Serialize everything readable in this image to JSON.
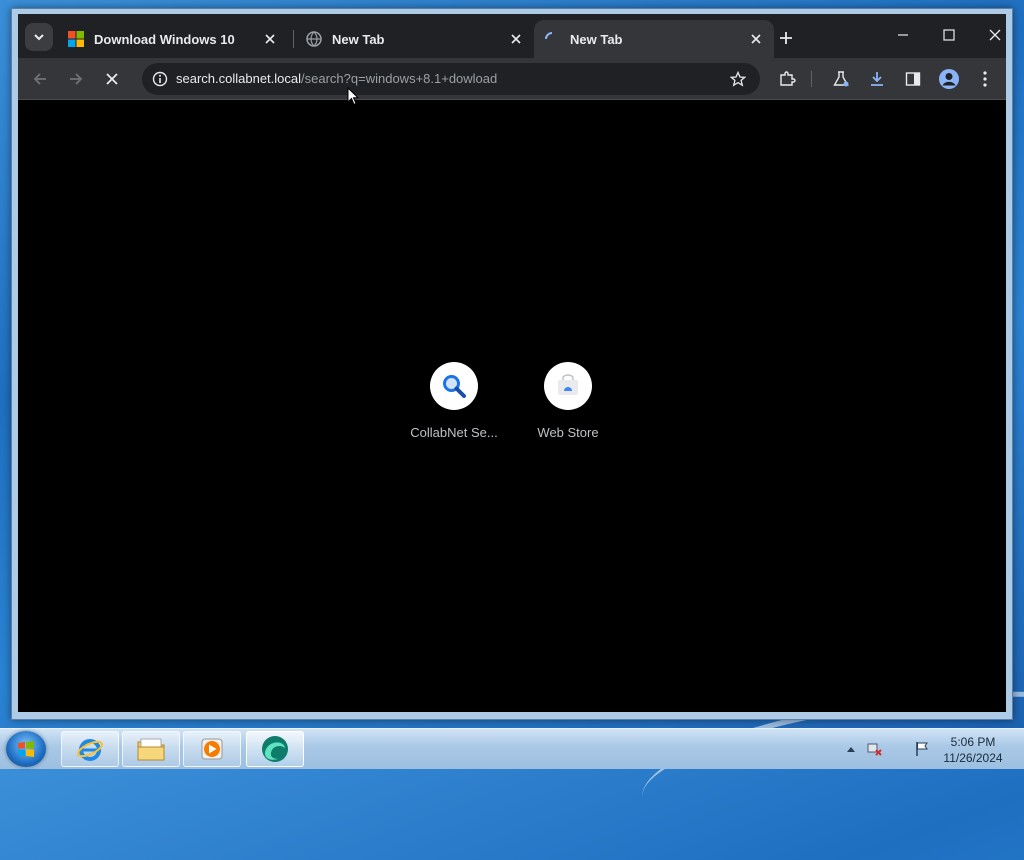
{
  "browser": {
    "tabs": [
      {
        "title": "Download Windows 10",
        "icon": "windows-logo-icon",
        "active": false
      },
      {
        "title": "New Tab",
        "icon": "globe-icon",
        "active": false
      },
      {
        "title": "New Tab",
        "icon": "loading-spinner-icon",
        "active": true
      }
    ],
    "address": {
      "host": "search.collabnet.local",
      "path": "/search?q=windows+8.1+dowload"
    },
    "toolbar_icons": [
      "back-icon",
      "forward-icon",
      "stop-icon",
      "site-info-icon",
      "bookmark-star-icon",
      "extensions-icon",
      "labs-flask-icon",
      "download-icon",
      "side-panel-icon",
      "profile-icon",
      "menu-icon"
    ]
  },
  "shortcuts": [
    {
      "title": "CollabNet Se...",
      "icon": "search-magnifier-icon"
    },
    {
      "title": "Web Store",
      "icon": "web-store-icon"
    }
  ],
  "taskbar": {
    "apps": [
      "internet-explorer-icon",
      "file-explorer-icon",
      "media-player-icon",
      "browser-app-icon"
    ],
    "time": "5:06 PM",
    "date": "11/26/2024"
  },
  "colors": {
    "titlebar": "#202124",
    "toolbar": "#35363a",
    "content": "#000000",
    "accent_blue": "#8ab4f8"
  }
}
